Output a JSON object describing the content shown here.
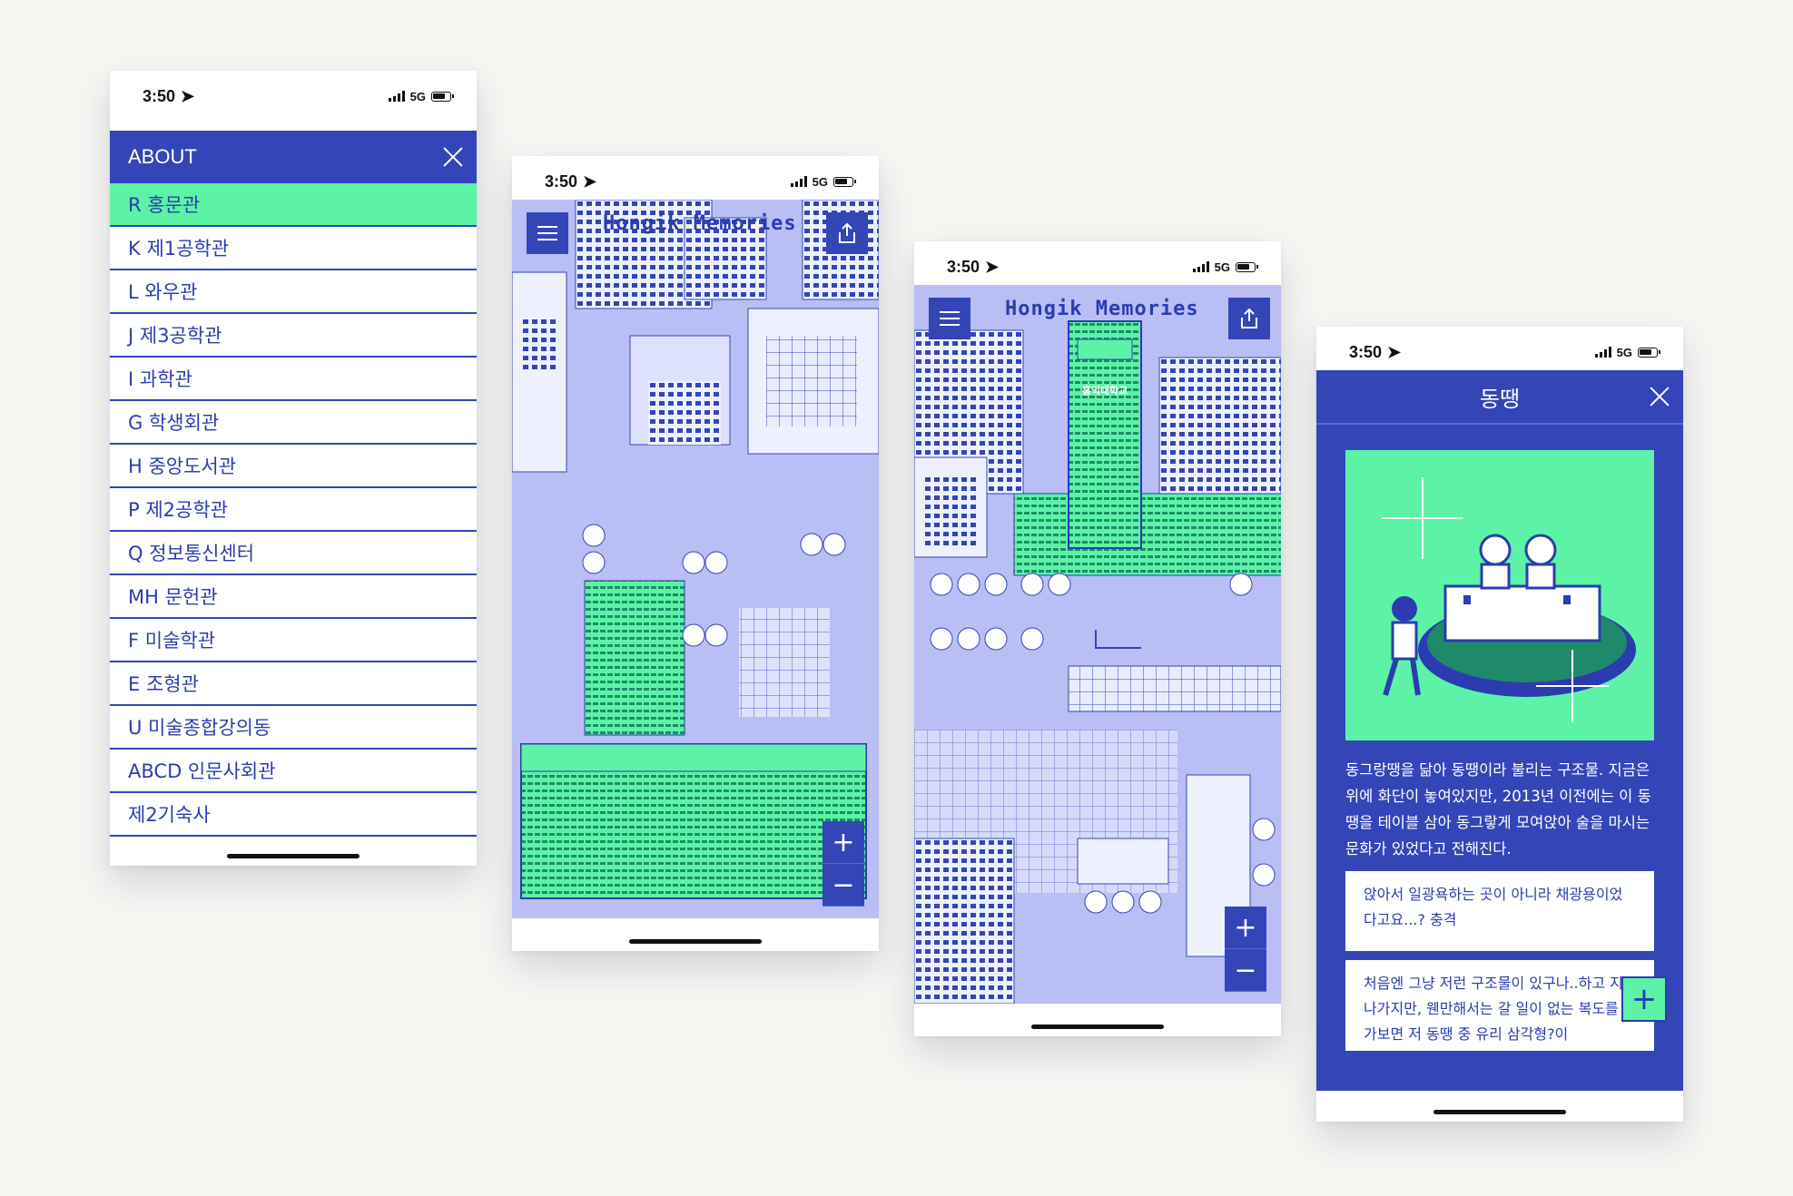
{
  "status": {
    "time": "3:50",
    "network": "5G"
  },
  "menu": {
    "title": "ABOUT",
    "items": [
      "R 홍문관",
      "K 제1공학관",
      "L 와우관",
      "J 제3공학관",
      "I 과학관",
      "G 학생회관",
      "H 중앙도서관",
      "P 제2공학관",
      "Q 정보통신센터",
      "MH 문헌관",
      "F 미술학관",
      "E 조형관",
      "U 미술종합강의동",
      "ABCD 인문사회관",
      "제2기숙사"
    ]
  },
  "map": {
    "title": "Hongik Memories",
    "sign": "홍익대학교",
    "zoom_in": "+",
    "zoom_out": "−"
  },
  "detail": {
    "title": "동땡",
    "description": "동그랑땡을 닮아 동땡이라 불리는 구조물. 지금은 위에 화단이 놓여있지만, 2013년 이전에는 이 동땡을 테이블 삼아 동그랗게 모여앉아 술을 마시는 문화가 있었다고 전해진다.",
    "comments": [
      "앉아서 일광욕하는 곳이 아니라 채광용이었다고요...? 충격",
      "처음엔 그냥 저런 구조물이 있구나..하고 지나가지만, 웬만해서는 갈 일이 없는 복도를 가보면 저 동땡 중 유리 삼각형?이"
    ],
    "add": "+"
  },
  "colors": {
    "primary": "#3445b8",
    "accent": "#5cf3a6",
    "map": "#b8bef5"
  }
}
